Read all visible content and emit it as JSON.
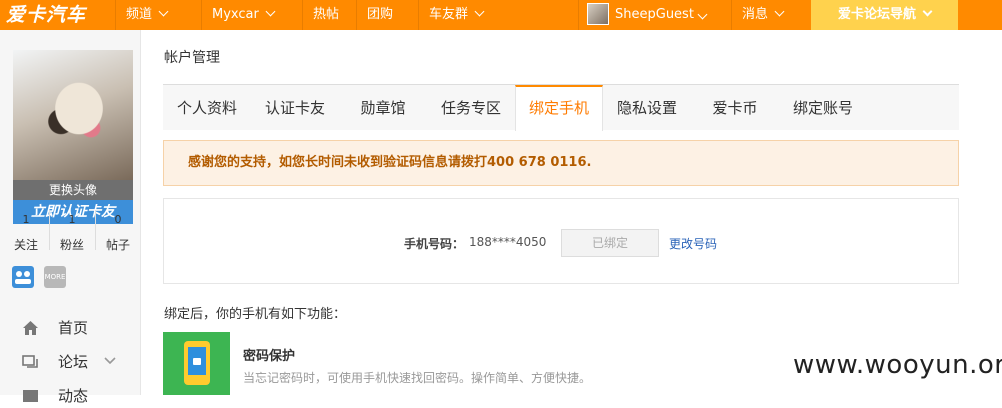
{
  "header": {
    "logo": "爱卡汽车",
    "nav": [
      "频道",
      "Myxcar",
      "热帖",
      "团购",
      "车友群"
    ],
    "username": "SheepGuest",
    "messages": "消息",
    "guide": "爱卡论坛导航"
  },
  "sidebar": {
    "change_avatar": "更换头像",
    "certify": "立即认证卡友",
    "stats": [
      {
        "num": "1",
        "label": "关注"
      },
      {
        "num": "1",
        "label": "粉丝"
      },
      {
        "num": "0",
        "label": "帖子"
      }
    ],
    "badge_more": "MORE",
    "menu": [
      {
        "label": "首页",
        "icon": "home-icon"
      },
      {
        "label": "论坛",
        "icon": "forum-icon"
      },
      {
        "label": "动态",
        "icon": "feed-icon"
      }
    ]
  },
  "main": {
    "title": "帐户管理",
    "tabs": [
      "个人资料",
      "认证卡友",
      "勋章馆",
      "任务专区",
      "绑定手机",
      "隐私设置",
      "爱卡币",
      "绑定账号"
    ],
    "active_tab": "绑定手机",
    "notice": "感谢您的支持，如您长时间未收到验证码信息请拨打400 678 0116.",
    "phone_label": "手机号码：",
    "phone_number": "188****4050",
    "bound_button": "已绑定",
    "change_link": "更改号码",
    "after_bind": "绑定后，你的手机有如下功能：",
    "feature_title": "密码保护",
    "feature_desc": "当忘记密码时，可使用手机快速找回密码。操作简单、方便快捷。"
  },
  "watermark": "www.wooyun.org",
  "colors": {
    "brand": "#ff8a00",
    "guide": "#ffd24d",
    "link": "#2a63b8",
    "active_tab": "#ff7b00"
  }
}
